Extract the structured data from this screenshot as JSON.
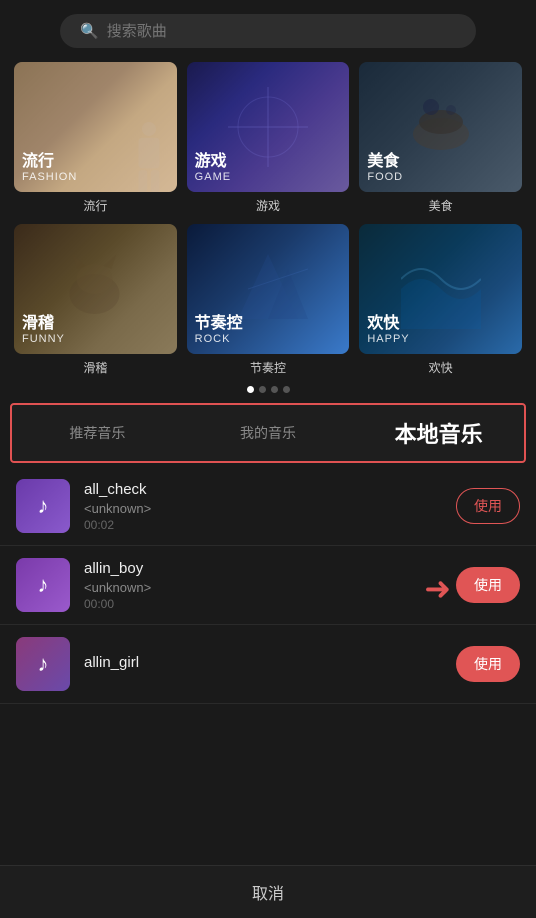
{
  "search": {
    "placeholder": "搜索歌曲"
  },
  "genres": [
    {
      "cn": "流行",
      "en": "FASHION",
      "label": "流行",
      "tile": "fashion"
    },
    {
      "cn": "游戏",
      "en": "GAME",
      "label": "游戏",
      "tile": "game"
    },
    {
      "cn": "美食",
      "en": "FOOD",
      "label": "美食",
      "tile": "food"
    },
    {
      "cn": "滑稽",
      "en": "FUNNY",
      "label": "滑稽",
      "tile": "funny"
    },
    {
      "cn": "节奏控",
      "en": "ROCK",
      "label": "节奏控",
      "tile": "rock"
    },
    {
      "cn": "欢快",
      "en": "HAPPY",
      "label": "欢快",
      "tile": "happy"
    }
  ],
  "tabs": [
    {
      "label": "推荐音乐",
      "active": false
    },
    {
      "label": "我的音乐",
      "active": false
    },
    {
      "label": "本地音乐",
      "active": true
    }
  ],
  "songs": [
    {
      "name": "all_check",
      "artist": "<unknown>",
      "duration": "00:02",
      "btn_label": "使用",
      "btn_type": "outline"
    },
    {
      "name": "allin_boy",
      "artist": "<unknown>",
      "duration": "00:00",
      "btn_label": "使用",
      "btn_type": "filled",
      "has_arrow": true
    },
    {
      "name": "allin_girl",
      "artist": "",
      "duration": "",
      "btn_label": "使用",
      "btn_type": "filled"
    }
  ],
  "cancel_label": "取消",
  "dots": [
    true,
    false,
    false,
    false
  ]
}
